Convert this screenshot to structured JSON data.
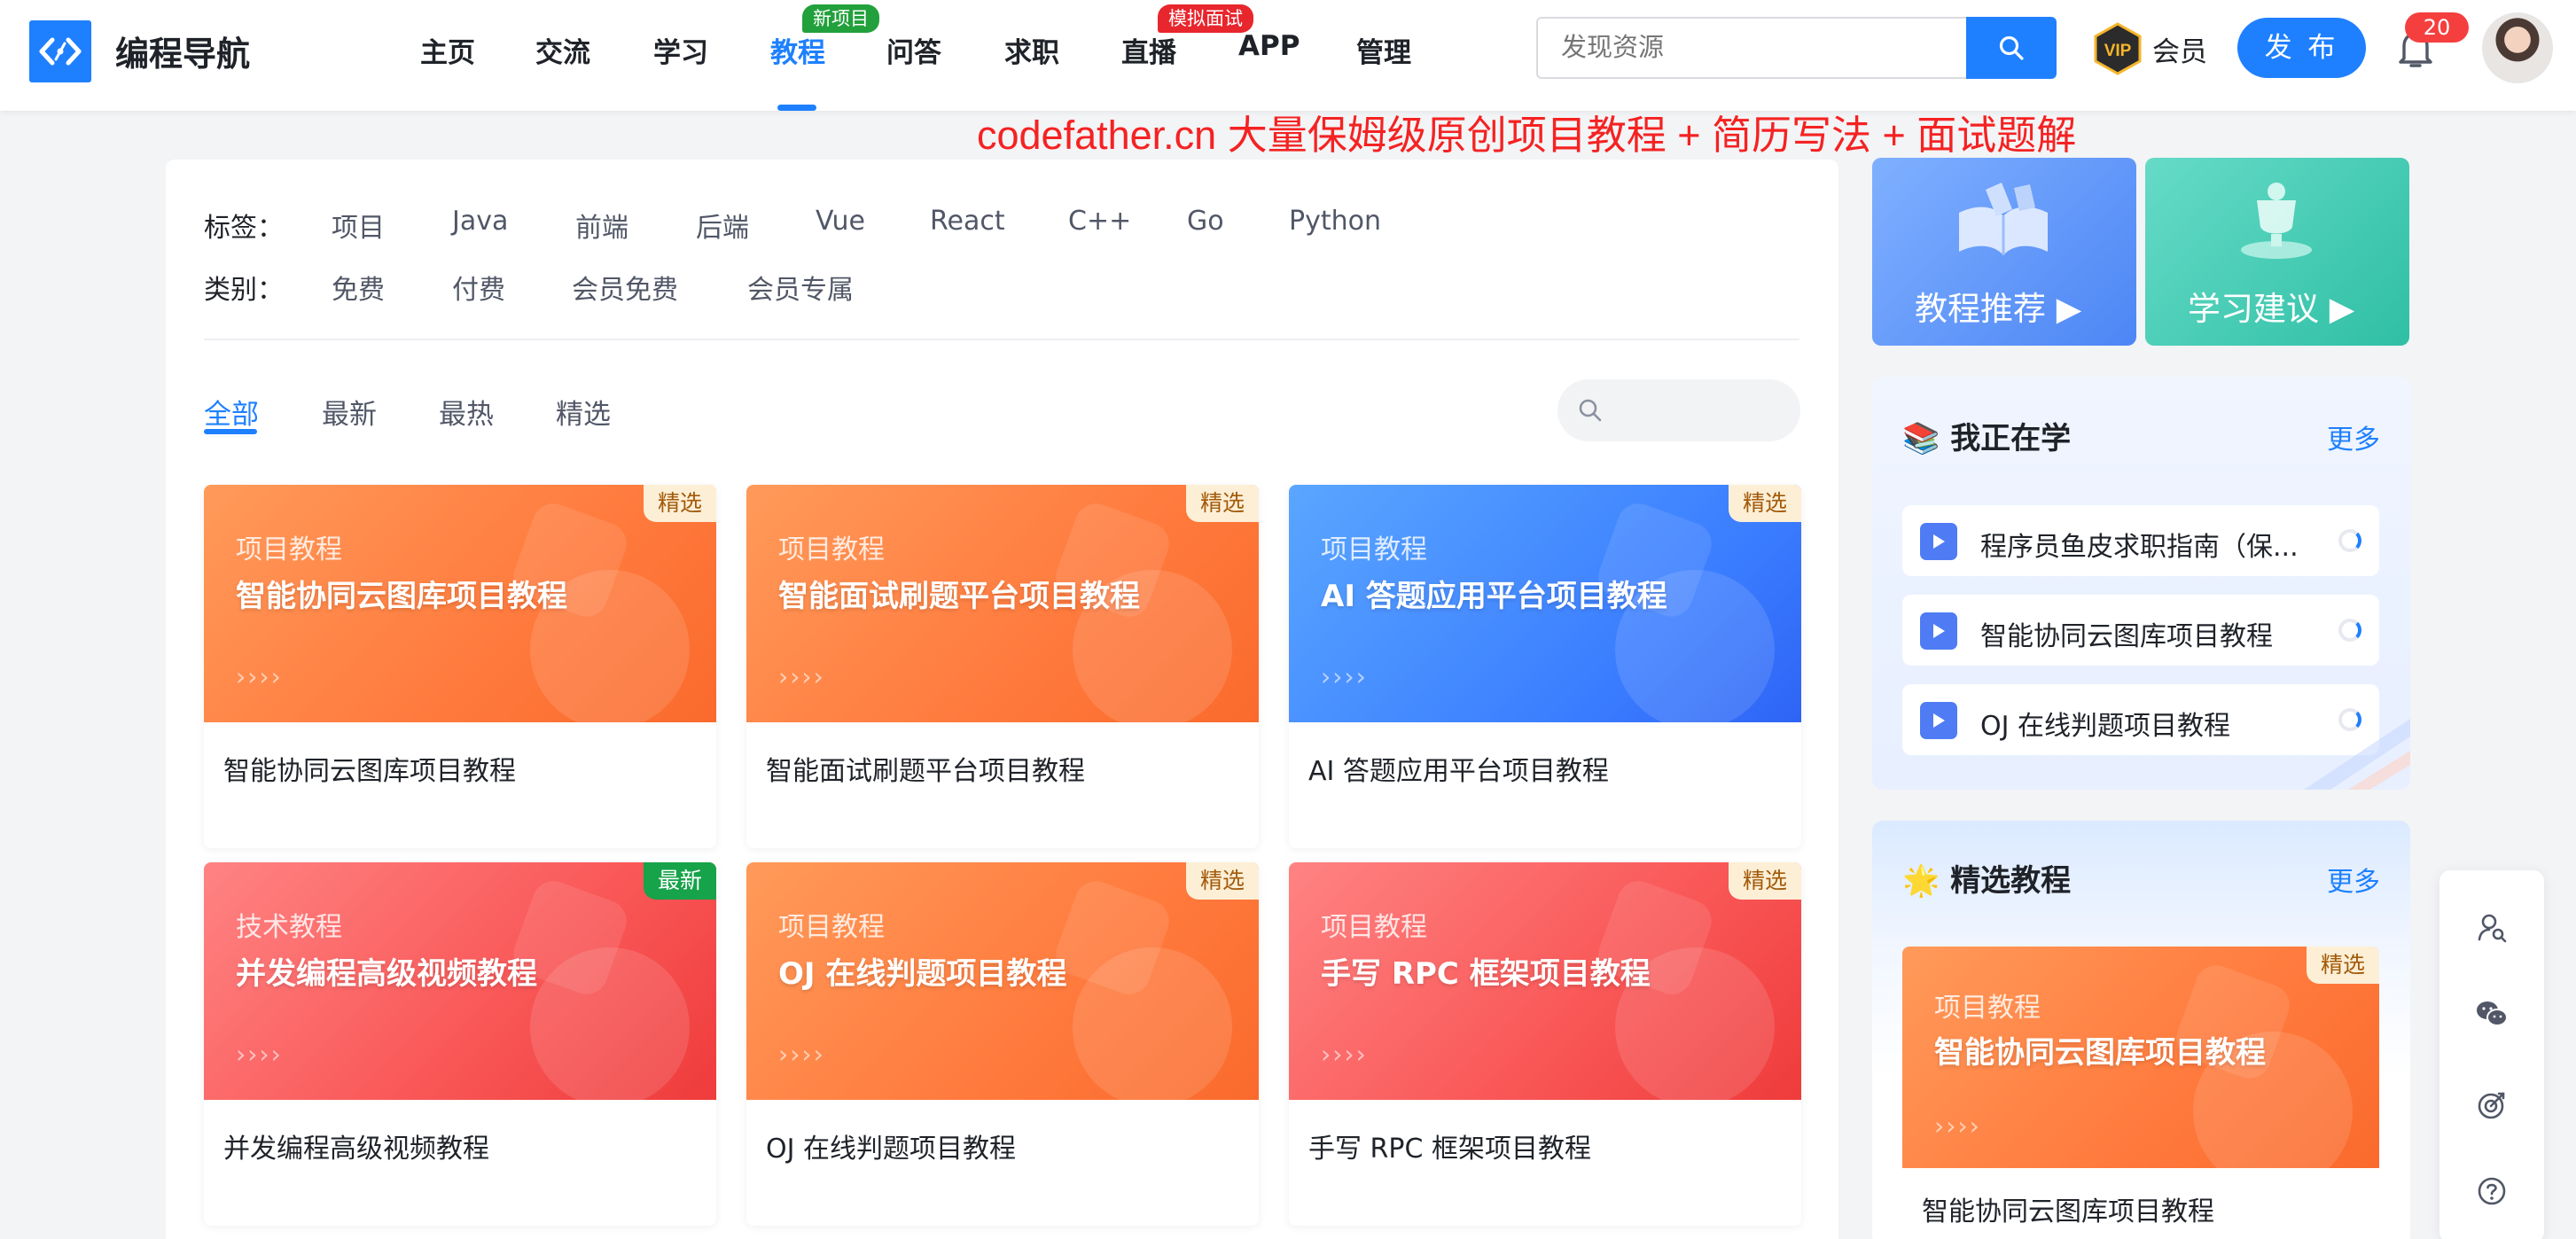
{
  "header": {
    "brand": "编程导航",
    "nav": [
      {
        "label": "主页"
      },
      {
        "label": "交流"
      },
      {
        "label": "学习"
      },
      {
        "label": "教程",
        "active": true,
        "badge": "新项目"
      },
      {
        "label": "问答"
      },
      {
        "label": "求职"
      },
      {
        "label": "直播",
        "badge": "模拟面试"
      },
      {
        "label": "APP"
      },
      {
        "label": "管理"
      }
    ],
    "search_placeholder": "发现资源",
    "vip_label": "会员",
    "vip_icon_text": "VIP",
    "publish_label": "发 布",
    "notification_count": "20",
    "colors": {
      "accent": "#1e80ff",
      "new_badge": "#22a03c",
      "hot_badge": "#e8262d"
    }
  },
  "promo_text": "codefather.cn 大量保姆级原创项目教程 + 简历写法 + 面试题解",
  "filters": {
    "tags_label": "标签：",
    "tags": [
      "项目",
      "Java",
      "前端",
      "后端",
      "Vue",
      "React",
      "C++",
      "Go",
      "Python"
    ],
    "category_label": "类别：",
    "categories": [
      "免费",
      "付费",
      "会员免费",
      "会员专属"
    ]
  },
  "sort_tabs": [
    {
      "label": "全部",
      "active": true
    },
    {
      "label": "最新"
    },
    {
      "label": "最热"
    },
    {
      "label": "精选"
    }
  ],
  "cards": [
    {
      "category": "项目教程",
      "cover_title": "智能协同云图库项目教程",
      "name": "智能协同云图库项目教程",
      "badge": "精选",
      "theme": "orange"
    },
    {
      "category": "项目教程",
      "cover_title": "智能面试刷题平台项目教程",
      "name": "智能面试刷题平台项目教程",
      "badge": "精选",
      "theme": "orange"
    },
    {
      "category": "项目教程",
      "cover_title": "AI 答题应用平台项目教程",
      "name": "AI 答题应用平台项目教程",
      "badge": "精选",
      "theme": "blue"
    },
    {
      "category": "技术教程",
      "cover_title": "并发编程高级视频教程",
      "name": "并发编程高级视频教程",
      "badge": "最新",
      "theme": "red"
    },
    {
      "category": "项目教程",
      "cover_title": "OJ 在线判题项目教程",
      "name": "OJ 在线判题项目教程",
      "badge": "精选",
      "theme": "orange"
    },
    {
      "category": "项目教程",
      "cover_title": "手写 RPC 框架项目教程",
      "name": "手写 RPC 框架项目教程",
      "badge": "精选",
      "theme": "red"
    }
  ],
  "cover_arrows": "››››",
  "sidebar": {
    "banners": [
      {
        "label": "教程推荐 ▶",
        "icon": "book-icon"
      },
      {
        "label": "学习建议 ▶",
        "icon": "trophy-icon"
      }
    ],
    "learning": {
      "icon": "📚",
      "title": "我正在学",
      "more": "更多",
      "items": [
        "程序员鱼皮求职指南（保...",
        "智能协同云图库项目教程",
        "OJ 在线判题项目教程"
      ]
    },
    "featured": {
      "icon": "🌟",
      "title": "精选教程",
      "more": "更多",
      "card": {
        "category": "项目教程",
        "cover_title": "智能协同云图库项目教程",
        "name": "智能协同云图库项目教程",
        "badge": "精选"
      }
    }
  },
  "float_tools": [
    "user-search-icon",
    "wechat-icon",
    "target-icon",
    "help-icon"
  ]
}
